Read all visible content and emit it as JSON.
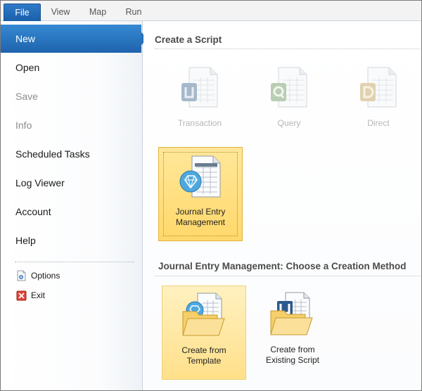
{
  "tabs": [
    {
      "label": "File"
    },
    {
      "label": "View"
    },
    {
      "label": "Map"
    },
    {
      "label": "Run"
    }
  ],
  "nav": {
    "items": [
      {
        "label": "New",
        "state": "active"
      },
      {
        "label": "Open"
      },
      {
        "label": "Save",
        "state": "disabled"
      },
      {
        "label": "Info",
        "state": "disabled"
      },
      {
        "label": "Scheduled Tasks"
      },
      {
        "label": "Log Viewer"
      },
      {
        "label": "Account"
      },
      {
        "label": "Help"
      }
    ],
    "small_items": [
      {
        "label": "Options",
        "icon": "options-page-icon"
      },
      {
        "label": "Exit",
        "icon": "exit-icon"
      }
    ]
  },
  "create_script": {
    "title": "Create a Script",
    "tiles": [
      {
        "label": "Transaction",
        "state": "disabled",
        "icon": "transaction-document-icon"
      },
      {
        "label": "Query",
        "state": "disabled",
        "icon": "query-document-icon"
      },
      {
        "label": "Direct",
        "state": "disabled",
        "icon": "direct-document-icon"
      }
    ],
    "selected_tile": {
      "label_line1": "Journal Entry",
      "label_line2": "Management",
      "icon": "journal-entry-document-icon"
    }
  },
  "creation_method": {
    "title": "Journal Entry Management: Choose a Creation Method",
    "tiles": [
      {
        "label_line1": "Create from",
        "label_line2": "Template",
        "icon": "template-folder-icon"
      },
      {
        "label_line1": "Create from",
        "label_line2": "Existing Script",
        "icon": "existing-script-folder-icon"
      }
    ]
  },
  "colors": {
    "accent": "#1f63ad",
    "selected_tile": "#ffd86a",
    "disabled_text": "#b6b6b6"
  }
}
